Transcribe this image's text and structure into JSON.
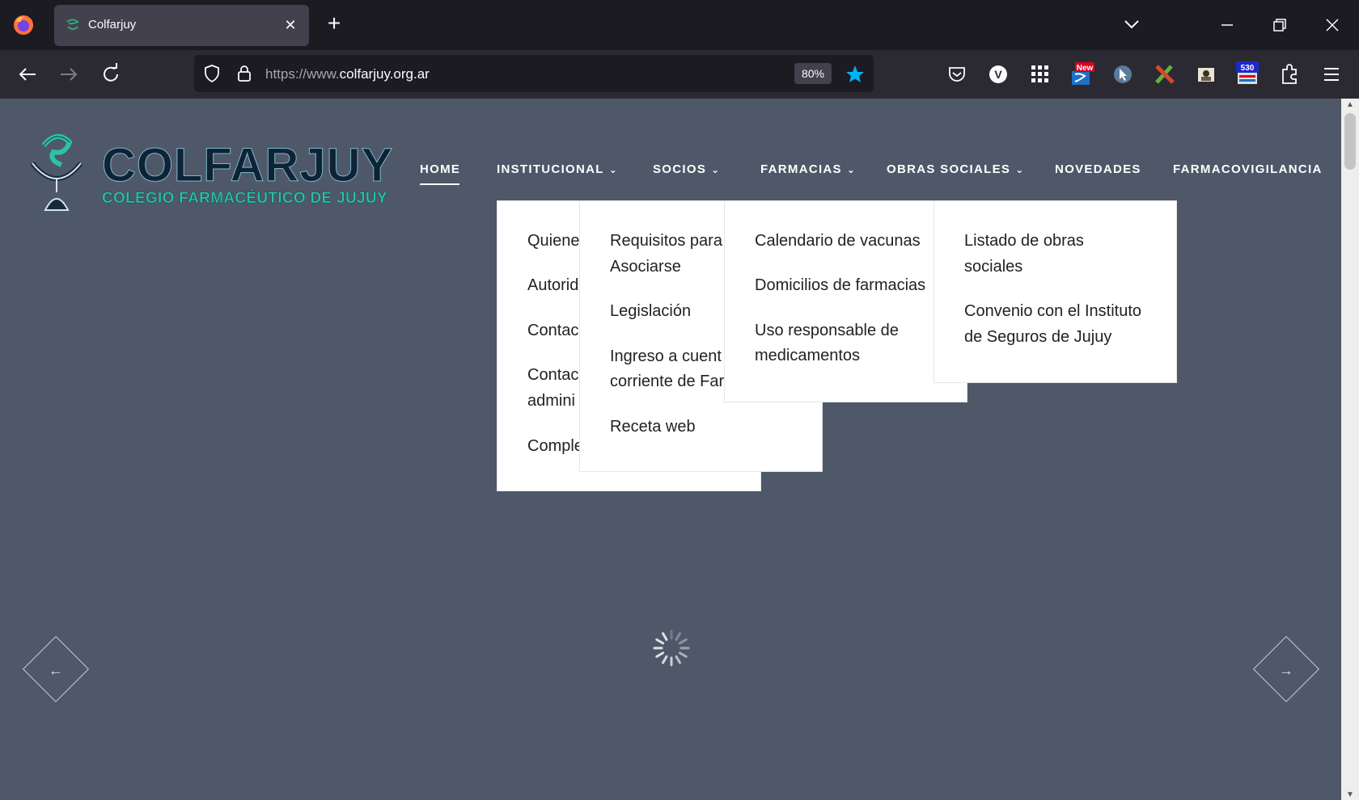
{
  "browser": {
    "tab_title": "Colfarjuy",
    "url_prefix": "https://www.",
    "url_domain": "colfarjuy.org.ar",
    "zoom": "80%",
    "extensions": [
      {
        "name": "pocket-icon"
      },
      {
        "name": "vimeo-icon",
        "glyph": "V"
      },
      {
        "name": "apps-grid-icon"
      },
      {
        "name": "news-extension-icon",
        "badge": "New"
      },
      {
        "name": "cursor-extension-icon"
      },
      {
        "name": "pencil-extension-icon"
      },
      {
        "name": "photo-extension-icon"
      },
      {
        "name": "counter-extension-icon",
        "badge": "530"
      },
      {
        "name": "extensions-puzzle-icon"
      },
      {
        "name": "menu-icon"
      }
    ]
  },
  "site": {
    "logo_name": "COLFARJUY",
    "logo_subtitle": "COLEGIO FARMACÉUTICO DE JUJUY",
    "nav": {
      "home": "HOME",
      "institucional": "INSTITUCIONAL",
      "socios": "SOCIOS",
      "farmacias": "FARMACIAS",
      "obras_sociales": "OBRAS SOCIALES",
      "novedades": "NOVEDADES",
      "farmacovigilancia": "FARMACOVIGILANCIA"
    },
    "menu_institucional": [
      "Quiene",
      "Autorid",
      "Contac",
      "Contac",
      "admini",
      "Comple"
    ],
    "menu_socios": [
      "Requisitos para",
      "Asociarse",
      "Legislación",
      "Ingreso a cuent",
      "corriente de Far",
      "Receta web"
    ],
    "menu_farmacias": [
      "Calendario de vacunas",
      "Domicilios de farmacias",
      "Uso responsable de",
      "medicamentos"
    ],
    "menu_obras_sociales": [
      "Listado de obras",
      "sociales",
      "Convenio con el Instituto",
      "de Seguros de Jujuy"
    ],
    "colors": {
      "page_bg": "#4f5869",
      "accent": "#2cc3a4",
      "chrome_dark": "#1c1b22",
      "chrome": "#2b2a33"
    }
  }
}
